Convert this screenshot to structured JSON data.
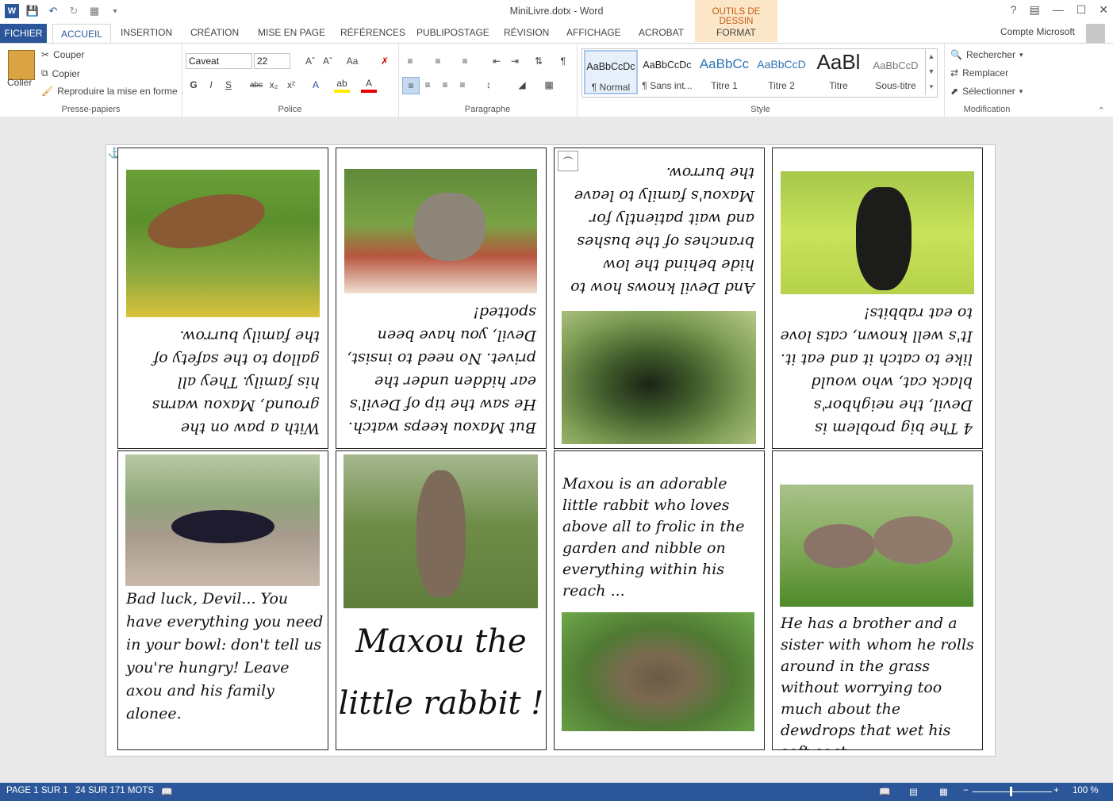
{
  "window": {
    "title": "MiniLivre.dotx - Word",
    "help": "?",
    "minimize": "—",
    "maximize": "☐",
    "close": "✕"
  },
  "contextual": {
    "group_label": "OUTILS DE DESSIN",
    "format_tab": "FORMAT"
  },
  "tabs": {
    "fichier": "FICHIER",
    "accueil": "ACCUEIL",
    "insertion": "INSERTION",
    "creation": "CRÉATION",
    "mise_en_page": "MISE EN PAGE",
    "references": "RÉFÉRENCES",
    "publipostage": "PUBLIPOSTAGE",
    "revision": "RÉVISION",
    "affichage": "AFFICHAGE",
    "acrobat": "ACROBAT"
  },
  "account": "Compte Microsoft",
  "clipboard": {
    "paste": "Coller",
    "cut": "Couper",
    "copy": "Copier",
    "format_painter": "Reproduire la mise en forme",
    "label": "Presse-papiers"
  },
  "font": {
    "name": "Caveat",
    "size": "22",
    "label": "Police",
    "bold": "G",
    "italic": "I",
    "underline": "S",
    "strike": "abc",
    "sub": "x₂",
    "sup": "x²"
  },
  "paragraph": {
    "label": "Paragraphe"
  },
  "styles": {
    "label": "Style",
    "items": [
      {
        "preview": "AaBbCcDc",
        "name": "¶ Normal"
      },
      {
        "preview": "AaBbCcDc",
        "name": "¶ Sans int..."
      },
      {
        "preview": "AaBbCc",
        "name": "Titre 1"
      },
      {
        "preview": "AaBbCcD",
        "name": "Titre 2"
      },
      {
        "preview": "AaBl",
        "name": "Titre"
      },
      {
        "preview": "AaBbCcD",
        "name": "Sous-titre"
      }
    ]
  },
  "editing": {
    "find": "Rechercher",
    "replace": "Remplacer",
    "select": "Sélectionner",
    "label": "Modification"
  },
  "book": {
    "title_line1": "Maxou the",
    "title_line2": "little rabbit !",
    "p_intro": "Maxou is an adorable little rabbit who loves above all to frolic in the garden and nibble on everything within his reach ...",
    "p_siblings": "He has a brother and a sister with whom he rolls around in the grass without worrying too much about the dewdrops that wet his soft coat.",
    "p_badluck": "Bad luck, Devil... You have everything you need in your bowl: don't tell us you're hungry! Leave axou and his family alonee.",
    "p_paw": "With a paw on the ground, Maxou warns his family. They all gallop to the safety of the family burrow.",
    "p_watch": "But Maxou keeps watch. He saw the tip of Devil's ear hidden under the privet. No need to insist, Devil, you have been spotted!",
    "p_devil": "And Devil knows how to hide behind the low branches of the bushes and wait patiently for Maxou's family to leave the burrow.",
    "p_problem": "4 The big problem is Devil, the neighbor's black cat, who would like to catch it and eat it. It's well known, cats love to eat rabbits!"
  },
  "status": {
    "page": "PAGE 1 SUR 1",
    "words": "24 SUR 171 MOTS",
    "zoom": "100 %"
  },
  "colors": {
    "accent": "#2b579a",
    "context": "#c55a11",
    "context_bg": "#fbe7c8"
  }
}
